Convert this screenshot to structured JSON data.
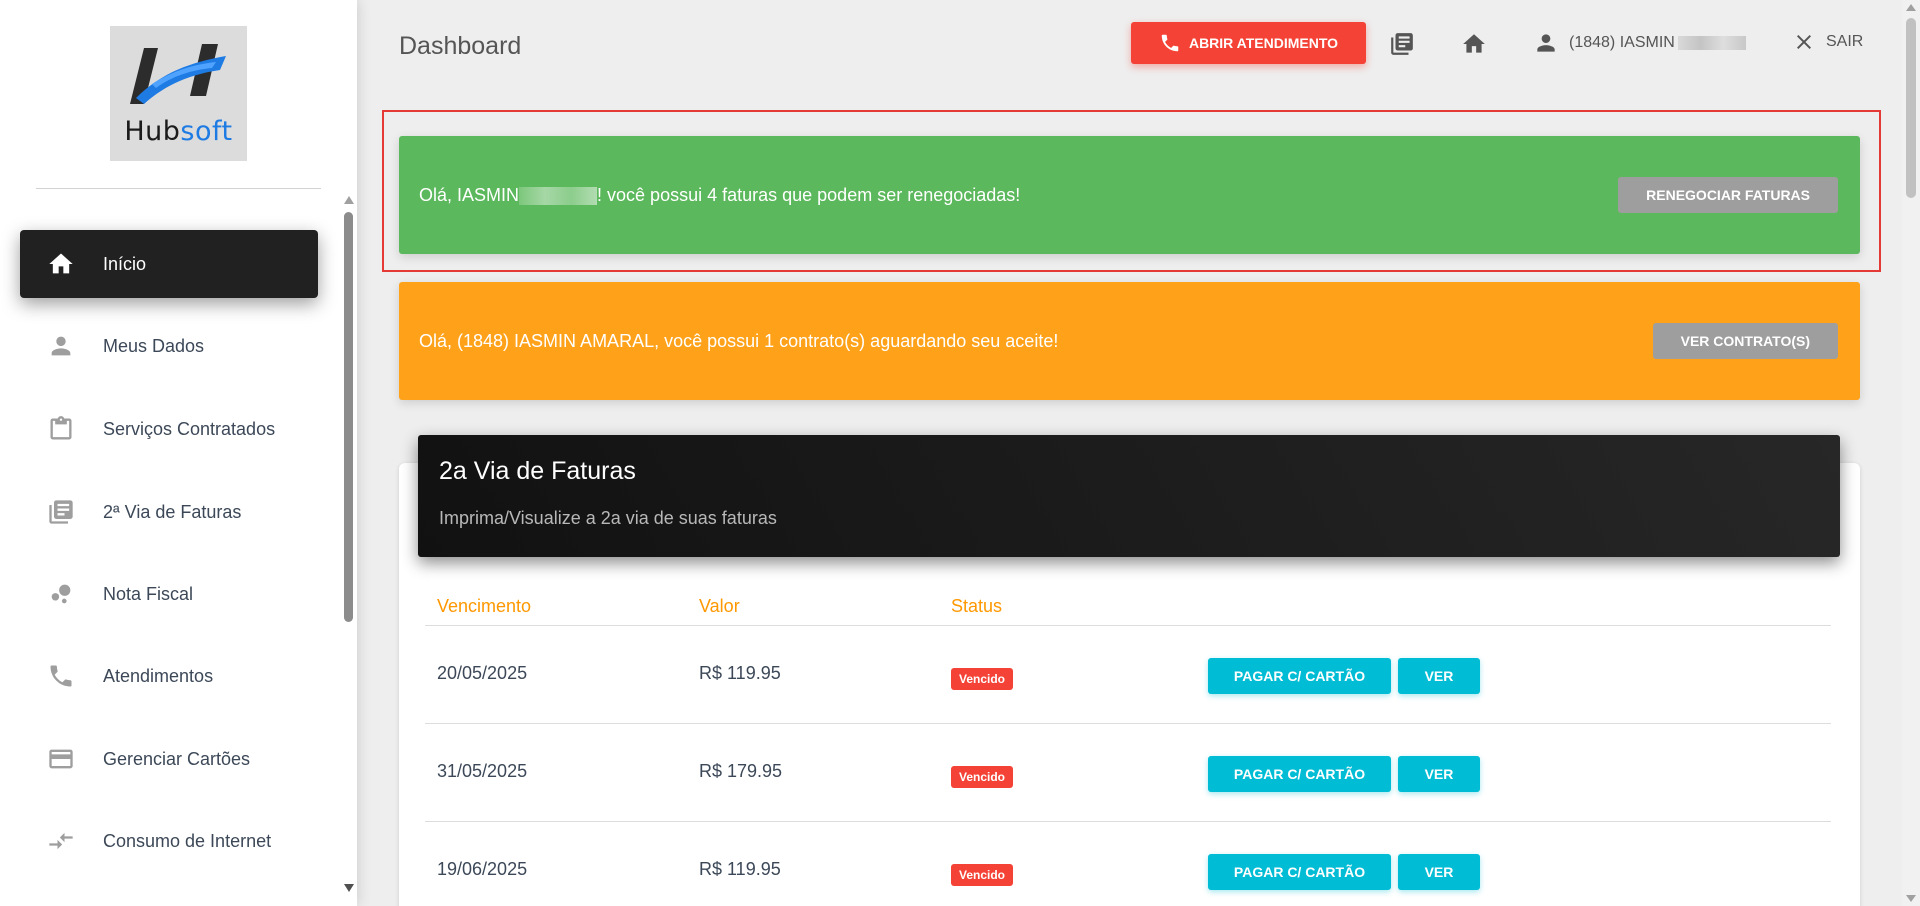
{
  "brand": {
    "logo_text_a": "Hub",
    "logo_text_b": "soft",
    "accent": "#1e7be3"
  },
  "sidebar": {
    "items": [
      {
        "label": "Início",
        "icon": "home-icon",
        "active": true
      },
      {
        "label": "Meus Dados",
        "icon": "person-icon"
      },
      {
        "label": "Serviços Contratados",
        "icon": "clipboard-icon"
      },
      {
        "label": "2ª Via de Faturas",
        "icon": "library-books-icon"
      },
      {
        "label": "Nota Fiscal",
        "icon": "bubble-chart-icon"
      },
      {
        "label": "Atendimentos",
        "icon": "phone-icon"
      },
      {
        "label": "Gerenciar Cartões",
        "icon": "credit-card-icon"
      },
      {
        "label": "Consumo de Internet",
        "icon": "compare-arrows-icon"
      }
    ]
  },
  "header": {
    "title": "Dashboard",
    "abrir_label": "ABRIR ATENDIMENTO",
    "user_label": "(1848) IASMIN",
    "sair_label": "SAIR"
  },
  "alerts": {
    "renegociar": {
      "text_a": "Olá, IASMIN",
      "text_b": "! você possui 4 faturas que podem ser renegociadas!",
      "button": "RENEGOCIAR FATURAS",
      "color": "#5cb85c"
    },
    "contrato": {
      "text": "Olá, (1848) IASMIN AMARAL, você possui 1 contrato(s) aguardando seu aceite!",
      "button": "VER CONTRATO(S)",
      "color": "#ffa21a"
    }
  },
  "faturas": {
    "title": "2a Via de Faturas",
    "subtitle": "Imprima/Visualize a 2a via de suas faturas",
    "columns": [
      "Vencimento",
      "Valor",
      "Status"
    ],
    "rows": [
      {
        "vencimento": "20/05/2025",
        "valor": "R$ 119.95",
        "status": "Vencido"
      },
      {
        "vencimento": "31/05/2025",
        "valor": "R$ 179.95",
        "status": "Vencido"
      },
      {
        "vencimento": "19/06/2025",
        "valor": "R$ 119.95",
        "status": "Vencido"
      }
    ],
    "pagar_label": "PAGAR C/ CARTÃO",
    "ver_label": "VER"
  }
}
